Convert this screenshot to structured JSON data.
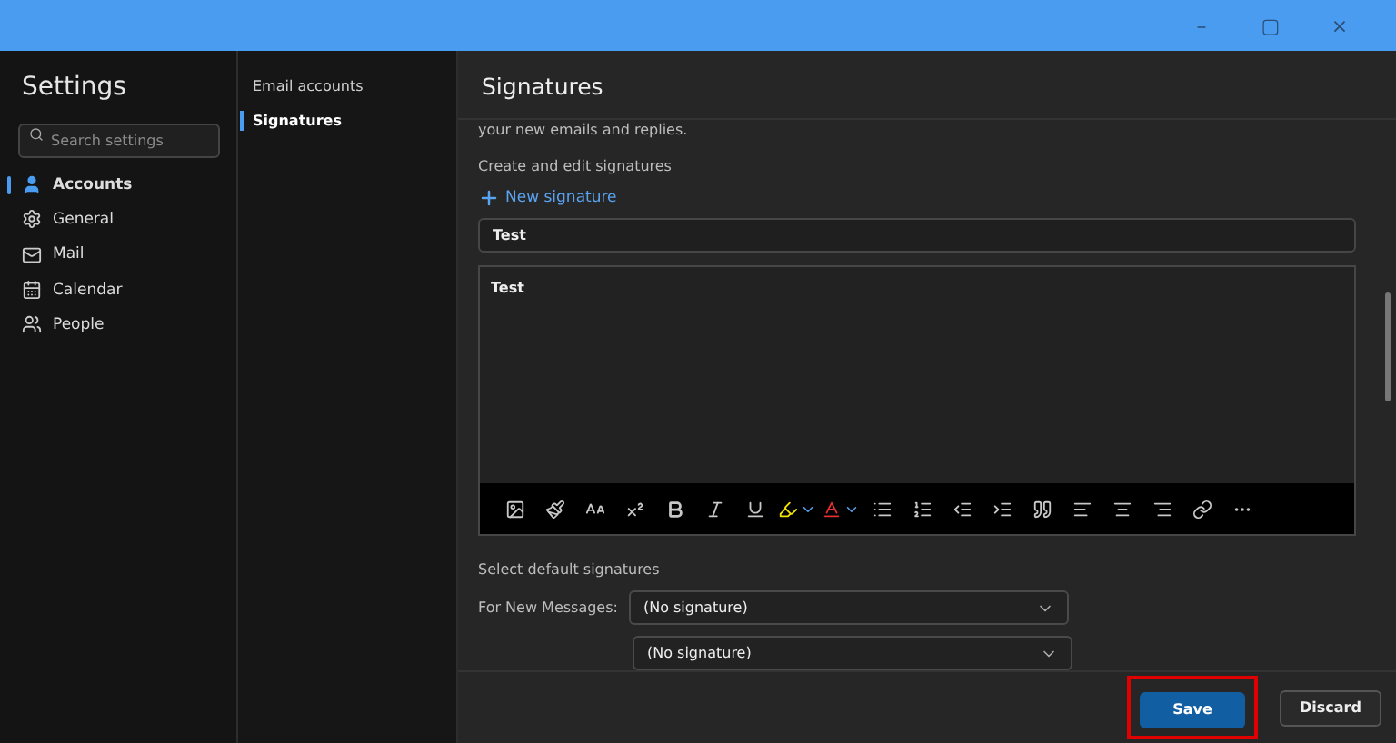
{
  "window": {
    "controls": [
      "–",
      "▢",
      "×"
    ]
  },
  "settings": {
    "title": "Settings",
    "search": {
      "placeholder": "Search settings"
    },
    "items": [
      {
        "label": "Accounts",
        "selected": true
      },
      {
        "label": "General",
        "selected": false
      },
      {
        "label": "Mail",
        "selected": false
      },
      {
        "label": "Calendar",
        "selected": false
      },
      {
        "label": "People",
        "selected": false
      }
    ]
  },
  "subnav": {
    "items": [
      {
        "label": "Email accounts",
        "selected": false
      },
      {
        "label": "Signatures",
        "selected": true
      }
    ]
  },
  "main": {
    "title": "Signatures",
    "intro": "your new emails and replies.",
    "create_label": "Create and edit signatures",
    "new_button": "New signature",
    "signature_name": "Test",
    "signature_body": "Test",
    "defaults_label": "Select default signatures",
    "defaults": [
      {
        "label": "For New Messages:",
        "value": "(No signature)"
      },
      {
        "value": "(No signature)"
      }
    ]
  },
  "footer": {
    "save": "Save",
    "discard": "Discard",
    "save_highlighted": true
  }
}
